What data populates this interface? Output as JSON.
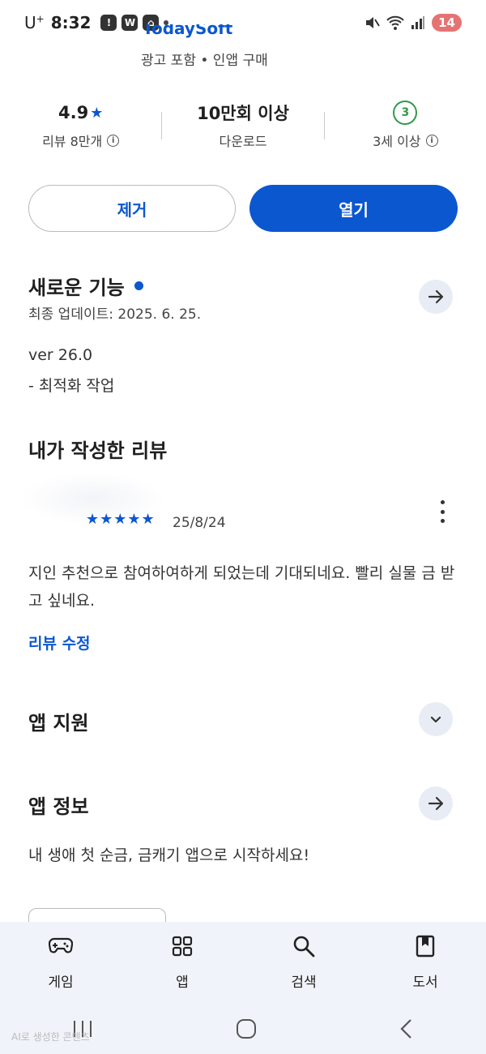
{
  "status_bar": {
    "carrier": "U",
    "carrier_sup": "+",
    "time": "8:32",
    "notification_w": "W",
    "battery": "14"
  },
  "app_header": {
    "developer_partial": "TodaySoft",
    "meta": "광고 포함 • 인앱 구매"
  },
  "stats": {
    "rating": "4.9",
    "rating_star": "★",
    "reviews_label": "리뷰 8만개",
    "downloads": "10만회 이상",
    "downloads_label": "다운로드",
    "age_badge": "3",
    "age_label": "3세 이상"
  },
  "actions": {
    "remove": "제거",
    "open": "열기"
  },
  "whats_new": {
    "title": "새로운 기능",
    "updated": "최종 업데이트: 2025. 6. 25.",
    "version": "ver 26.0",
    "note": "- 최적화 작업"
  },
  "my_review": {
    "title": "내가 작성한 리뷰",
    "stars": "★★★★★",
    "date": "25/8/24",
    "text": "지인 추천으로 참여하여하게 되었는데 기대되네요. 빨리 실물 금 받고 싶네요.",
    "edit_label": "리뷰 수정"
  },
  "app_support": {
    "title": "앱 지원"
  },
  "app_info": {
    "title": "앱 정보",
    "description": "내 생애 첫 순금, 금캐기 앱으로 시작하세요!"
  },
  "bottom_nav": {
    "items": [
      {
        "label": "게임",
        "icon": "gamepad-icon"
      },
      {
        "label": "앱",
        "icon": "apps-grid-icon"
      },
      {
        "label": "검색",
        "icon": "search-icon"
      },
      {
        "label": "도서",
        "icon": "book-icon"
      }
    ]
  },
  "watermark": "AI로 생성한 콘텐츠",
  "colors": {
    "accent": "#0b57d0",
    "age_green": "#2e9a4a",
    "nav_bg": "#f0f3f9",
    "chip_bg": "#e8ecf4"
  }
}
